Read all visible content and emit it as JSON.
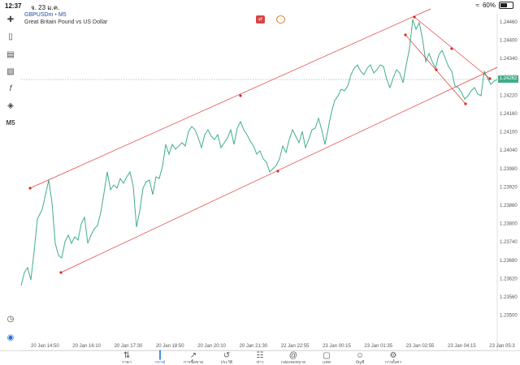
{
  "status": {
    "time": "12:37",
    "date": "จ. 23 ม.ค.",
    "battery": "60%",
    "battery_level": 0.6
  },
  "symbol": {
    "ticker": "GBPUSDm",
    "timeframe": "M5",
    "description": "Great Britain Pound vs US Dollar"
  },
  "chart": {
    "current_price": "1.24262",
    "price_labels": [
      "1.24460",
      "1.24400",
      "1.24340",
      "1.24280",
      "1.24220",
      "1.24160",
      "1.24100",
      "1.24040",
      "1.23980",
      "1.23920",
      "1.23860",
      "1.23800",
      "1.23740",
      "1.23680",
      "1.23620",
      "1.23560",
      "1.23500"
    ],
    "time_labels": [
      "20 Jan 14:50",
      "20 Jan 16:10",
      "20 Jan 17:30",
      "20 Jan 18:50",
      "20 Jan 20:10",
      "20 Jan 21:30",
      "22 Jan 22:55",
      "23 Jan 00:15",
      "23 Jan 01:35",
      "23 Jan 02:55",
      "23 Jan 04:15",
      "23 Jan 05:3"
    ],
    "line_color": "#3fae8a",
    "trendline_color": "#e03b3b"
  },
  "toolbar": {
    "timeframe_label": "M5"
  },
  "icons": {
    "crosshair": "crosshair-icon",
    "candles": "candlestick-icon",
    "indicators": "indicator-icon",
    "function": "function-icon",
    "objects": "objects-icon"
  },
  "nav": [
    {
      "label": "ราคา",
      "icon": "quotes-icon"
    },
    {
      "label": "กราฟ",
      "icon": "chart-icon"
    },
    {
      "label": "การซื้อขาย",
      "icon": "trade-icon"
    },
    {
      "label": "ประวัติ",
      "icon": "history-icon"
    },
    {
      "label": "ข่าว",
      "icon": "news-icon"
    },
    {
      "label": "กล่องจดหมาย",
      "icon": "mailbox-icon"
    },
    {
      "label": "แชท",
      "icon": "chat-icon"
    },
    {
      "label": "บัญชี",
      "icon": "account-icon"
    },
    {
      "label": "การตั้งค่า",
      "icon": "settings-icon"
    }
  ]
}
